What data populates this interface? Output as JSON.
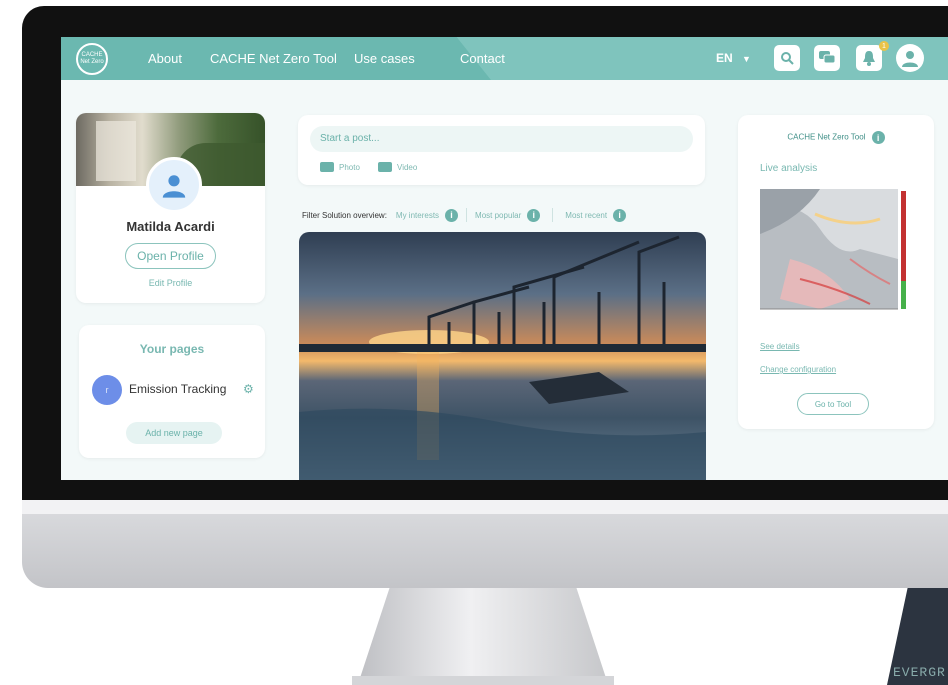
{
  "nav": {
    "logo_text": "CACHE Net Zero",
    "links": [
      "About",
      "CACHE Net Zero Tool",
      "Use cases",
      "Contact"
    ],
    "language": "EN",
    "notification_count": "1",
    "icons": [
      "search-icon",
      "chat-icon",
      "bell-icon",
      "user-icon"
    ]
  },
  "profile": {
    "name": "Matilda Acardi",
    "open_profile": "Open Profile",
    "edit_profile": "Edit Profile"
  },
  "pages": {
    "title": "Your pages",
    "items": [
      {
        "label": "Emission Tracking",
        "avatar_letter": "r"
      }
    ],
    "add_button": "Add new page"
  },
  "post": {
    "placeholder": "Start a post...",
    "photo": "Photo",
    "video": "Video"
  },
  "filter": {
    "label": "Filter Solution overview:",
    "options": [
      "My interests",
      "Most popular",
      "Most recent"
    ]
  },
  "tool_panel": {
    "title": "CACHE Net Zero Tool",
    "live_analysis": "Live analysis",
    "see_details": "See details",
    "change_configuration": "Change configuration",
    "go_to_tool": "Go to Tool"
  },
  "colors": {
    "accent": "#7fc4bd",
    "accent_dark": "#6bb2aa",
    "page_bg": "#f3f9f9"
  },
  "brand_text": "EVERGR"
}
